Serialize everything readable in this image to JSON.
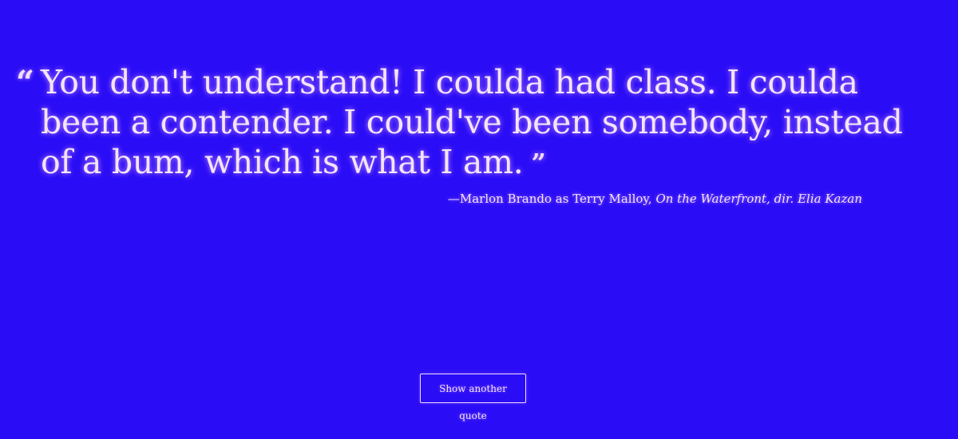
{
  "quote": {
    "open_mark": "“",
    "text": "You don't understand! I coulda had class. I coulda been a contender. I could've been somebody, instead of a bum, which is what I am.",
    "close_mark": "”"
  },
  "attribution": {
    "prefix": "—Marlon Brando as Terry Malloy, ",
    "work": "On the Waterfront, dir. Elia Kazan"
  },
  "button": {
    "label": "Show another quote"
  },
  "colors": {
    "background": "#2a0cf6",
    "text": "#f0dcf8"
  }
}
